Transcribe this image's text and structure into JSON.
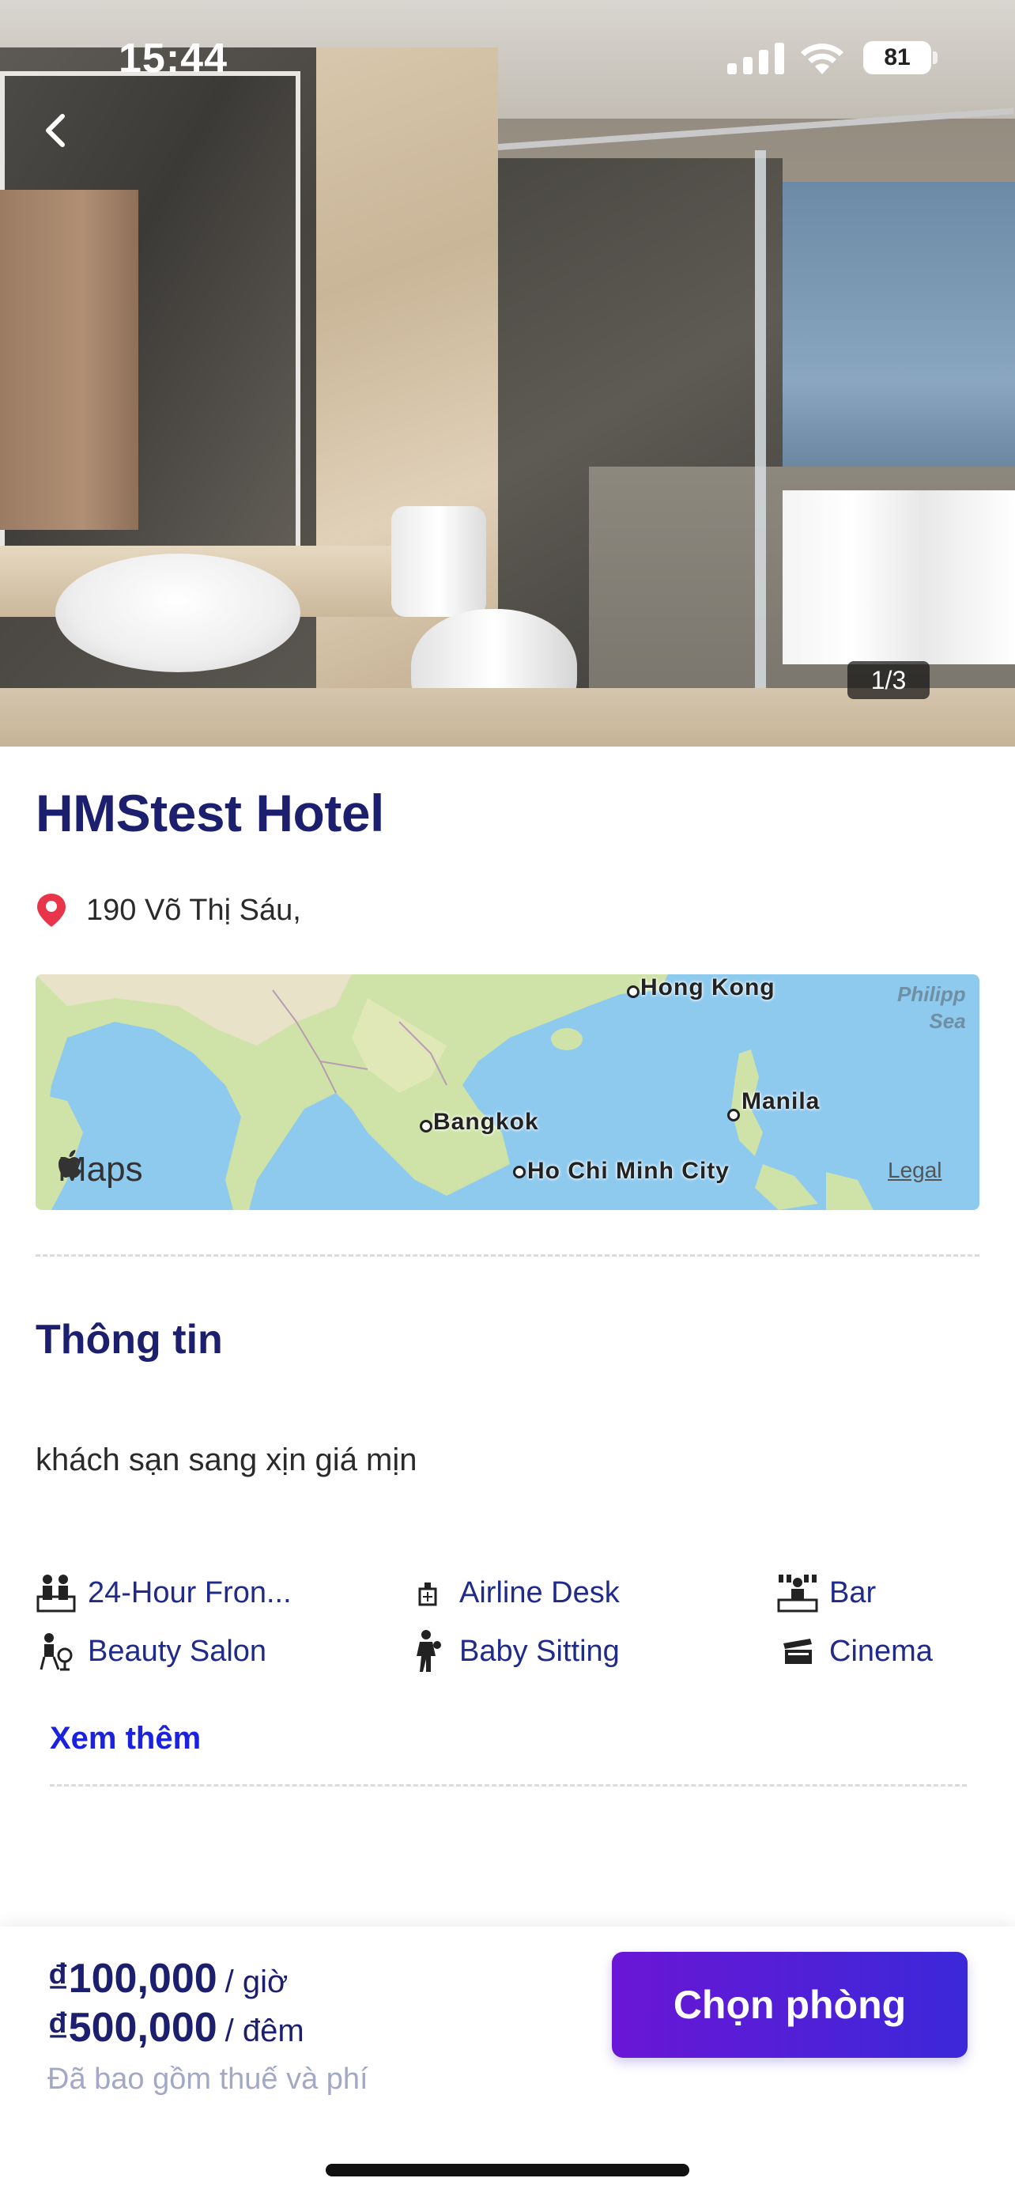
{
  "status_bar": {
    "time": "15:44",
    "battery": "81",
    "icons": [
      "signal-icon",
      "wifi-icon",
      "battery-icon"
    ]
  },
  "hero": {
    "back_icon": "chevron-left-icon",
    "photo_counter": "1/3"
  },
  "hotel": {
    "name": "HMStest Hotel",
    "address": "190 Võ Thị Sáu,",
    "address_icon": "location-pin-icon"
  },
  "map": {
    "labels": {
      "hong_kong": "Hong Kong",
      "manila": "Manila",
      "bangkok": "Bangkok",
      "ho_chi_minh": "Ho Chi Minh City",
      "sea_line1": "Philipp",
      "sea_line2": "Sea"
    },
    "logo_text": "Maps",
    "legal": "Legal"
  },
  "info": {
    "title": "Thông tin",
    "description": "khách sạn sang xịn giá mịn"
  },
  "amenities": [
    {
      "label": "24-Hour Fron...",
      "icon": "front-desk-icon"
    },
    {
      "label": "Airline Desk",
      "icon": "airline-desk-icon"
    },
    {
      "label": "Bar",
      "icon": "bar-icon"
    },
    {
      "label": "Beauty Salon",
      "icon": "beauty-salon-icon"
    },
    {
      "label": "Baby Sitting",
      "icon": "baby-sitting-icon"
    },
    {
      "label": "Cinema",
      "icon": "cinema-icon"
    }
  ],
  "see_more": "Xem thêm",
  "booking": {
    "price_hour": "₫100,000",
    "unit_hour": "/ giờ",
    "price_night": "₫500,000",
    "unit_night": "/ đêm",
    "tax_note": "Đã bao gồm thuế và phí",
    "button_label": "Chọn phòng"
  },
  "colors": {
    "title_navy": "#1c1f6e",
    "link_blue": "#1a22e0",
    "button_gradient_start": "#6a16d6",
    "button_gradient_end": "#3b28d8",
    "pin_red": "#e8354a"
  }
}
